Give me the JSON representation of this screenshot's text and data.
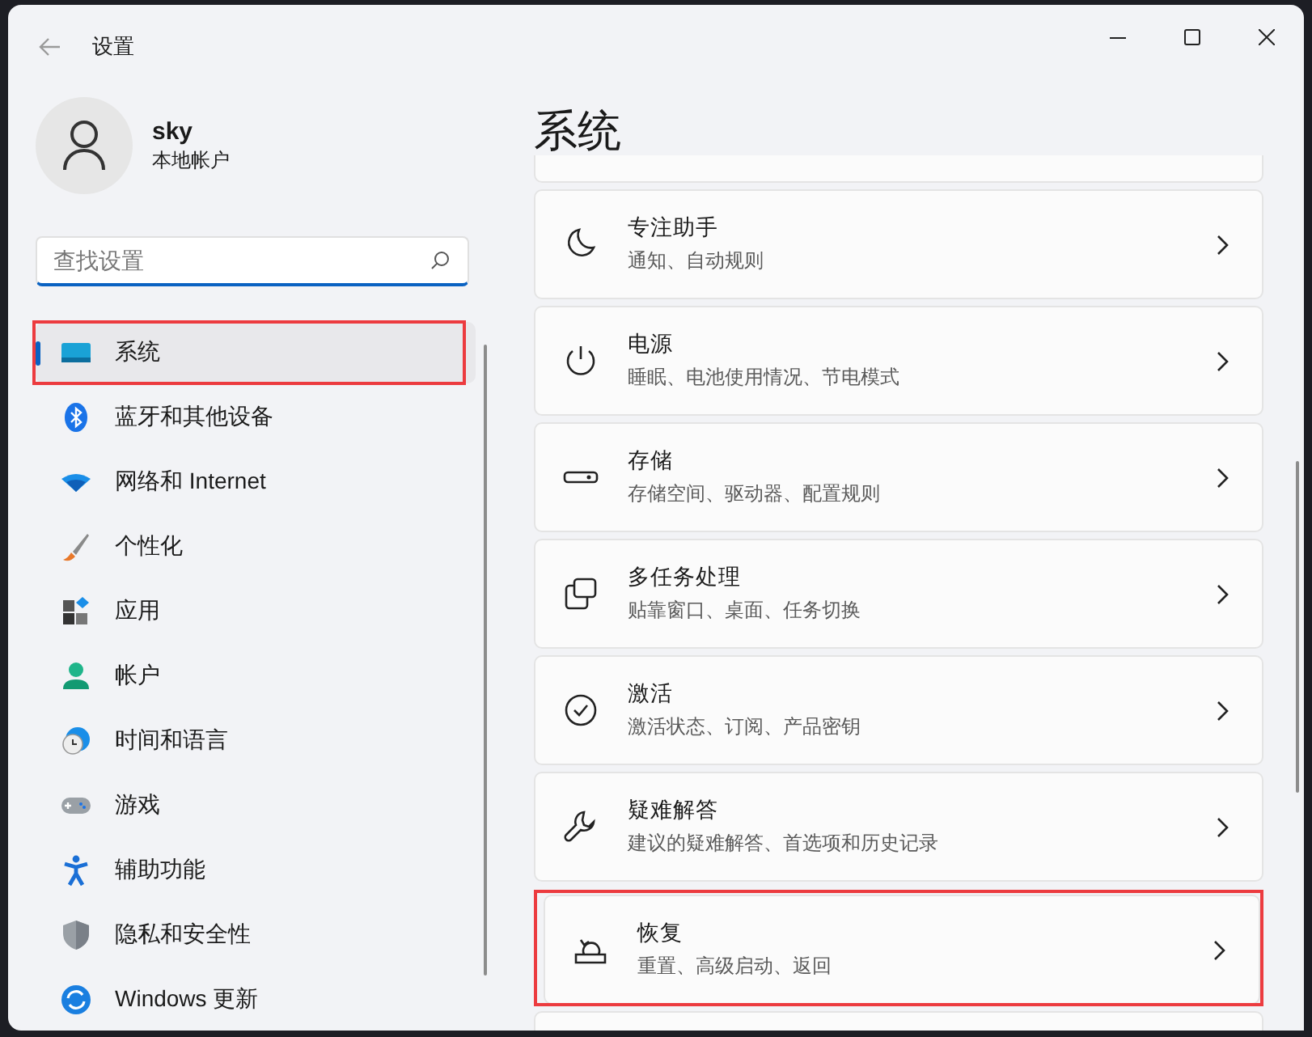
{
  "window": {
    "title": "设置"
  },
  "profile": {
    "name": "sky",
    "account_type": "本地帐户"
  },
  "search": {
    "placeholder": "查找设置"
  },
  "nav": [
    {
      "label": "系统",
      "kind": "system",
      "selected": true,
      "highlighted": true
    },
    {
      "label": "蓝牙和其他设备",
      "kind": "bluetooth",
      "selected": false,
      "highlighted": false
    },
    {
      "label": "网络和 Internet",
      "kind": "network",
      "selected": false,
      "highlighted": false
    },
    {
      "label": "个性化",
      "kind": "personalize",
      "selected": false,
      "highlighted": false
    },
    {
      "label": "应用",
      "kind": "apps",
      "selected": false,
      "highlighted": false
    },
    {
      "label": "帐户",
      "kind": "accounts",
      "selected": false,
      "highlighted": false
    },
    {
      "label": "时间和语言",
      "kind": "time",
      "selected": false,
      "highlighted": false
    },
    {
      "label": "游戏",
      "kind": "gaming",
      "selected": false,
      "highlighted": false
    },
    {
      "label": "辅助功能",
      "kind": "accessibility",
      "selected": false,
      "highlighted": false
    },
    {
      "label": "隐私和安全性",
      "kind": "privacy",
      "selected": false,
      "highlighted": false
    },
    {
      "label": "Windows 更新",
      "kind": "update",
      "selected": false,
      "highlighted": false
    }
  ],
  "page": {
    "title": "系统"
  },
  "cards": [
    {
      "title": "专注助手",
      "subtitle": "通知、自动规则",
      "kind": "focus",
      "highlighted": false
    },
    {
      "title": "电源",
      "subtitle": "睡眠、电池使用情况、节电模式",
      "kind": "power",
      "highlighted": false
    },
    {
      "title": "存储",
      "subtitle": "存储空间、驱动器、配置规则",
      "kind": "storage",
      "highlighted": false
    },
    {
      "title": "多任务处理",
      "subtitle": "贴靠窗口、桌面、任务切换",
      "kind": "multitasking",
      "highlighted": false
    },
    {
      "title": "激活",
      "subtitle": "激活状态、订阅、产品密钥",
      "kind": "activation",
      "highlighted": false
    },
    {
      "title": "疑难解答",
      "subtitle": "建议的疑难解答、首选项和历史记录",
      "kind": "troubleshoot",
      "highlighted": false
    },
    {
      "title": "恢复",
      "subtitle": "重置、高级启动、返回",
      "kind": "recovery",
      "highlighted": true
    }
  ]
}
